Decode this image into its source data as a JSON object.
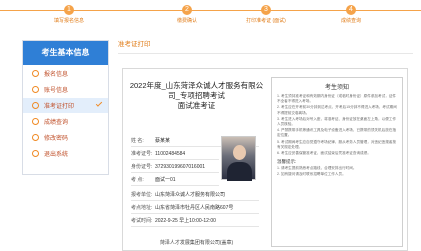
{
  "steps": [
    {
      "num": "1",
      "label": "填写报名信息"
    },
    {
      "num": "2",
      "label": "缴费确认"
    },
    {
      "num": "3",
      "label": "打印准考证 (面试)"
    },
    {
      "num": "4",
      "label": "成绩查询"
    }
  ],
  "sidebar": {
    "title": "考生基本信息",
    "items": [
      {
        "label": "报名信息"
      },
      {
        "label": "账号信息"
      },
      {
        "label": "准考证打印"
      },
      {
        "label": "成绩查询"
      },
      {
        "label": "修改密码"
      },
      {
        "label": "退出系统"
      }
    ]
  },
  "page": {
    "title": "准考证打印"
  },
  "ticket": {
    "title_line1": "2022年度_山东菏泽众诚人才服务有限公",
    "title_line2": "司_专项招聘考试",
    "title_line3": "面试准考证",
    "fields": [
      {
        "key": "姓  名:",
        "value": "蔡某某"
      },
      {
        "key": "准考证号:",
        "value": "11002484584"
      },
      {
        "key": "身份证号:",
        "value": "372930199607016001"
      },
      {
        "key": "考  点:",
        "value": "面试一01"
      },
      {
        "key": "报考单位:",
        "value": "山东菏泽众诚人才服务有限公司"
      },
      {
        "key": "考点地址:",
        "value": "山东省菏泽市牡丹区人民南路607号"
      },
      {
        "key": "考试时间:",
        "value": "2022-9-25 早上10:00-12:00"
      }
    ],
    "footer": "菏泽人才发展集团有限公司(盖章)"
  },
  "notice": {
    "title": "考生须知",
    "paragraphs": [
      "1. 考生须持准考证和有效期内身份证（或临时身份证）原件参加考试，证件不全者不得进入考场。",
      "2. 考生应在开考前30分钟到达考点，开考后15分钟不得进入考场，考试期间不得提前交卷离场。",
      "3. 考生进入考场后对号入座，将准考证、身份证放在桌面左上角，以便工作人员核验。",
      "4. 严禁携带手机等通讯工具及电子设备进入考场，已携带的须关机后放在指定位置。",
      "5. 考试期间考生应自觉遵守考场纪律，服从考务人员管理，对违纪违规者按有关规定处理。",
      "6. 考生应妥善保管准考证，面试结束后凭准考证查询成绩。"
    ],
    "sub_title": "温馨提示:",
    "tips": [
      "1. 请考生提前熟悉考点路线，合理安排出行时间。",
      "2. 如有疑问请及时联系招聘单位工作人员。"
    ]
  }
}
